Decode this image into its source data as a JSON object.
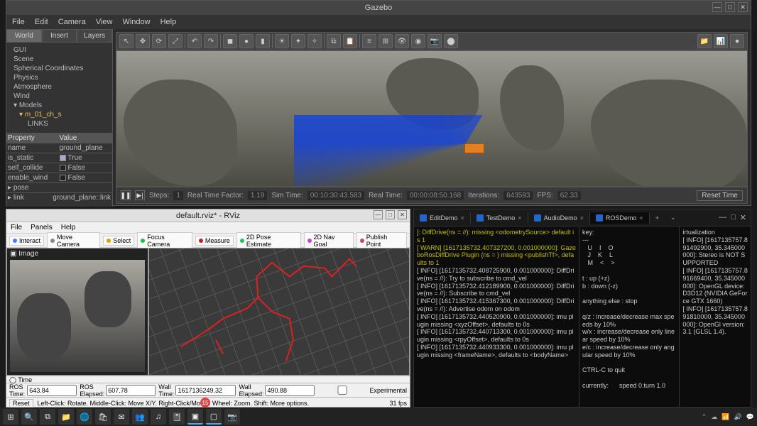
{
  "gazebo": {
    "title": "Gazebo",
    "menu": [
      "File",
      "Edit",
      "Camera",
      "View",
      "Window",
      "Help"
    ],
    "side_tabs": [
      "World",
      "Insert",
      "Layers"
    ],
    "tree": {
      "items": [
        "GUI",
        "Scene",
        "Spherical Coordinates",
        "Physics",
        "Atmosphere",
        "Wind"
      ],
      "models_label": "Models",
      "selected": "m_01_ch_s",
      "links_label": "LINKS"
    },
    "props": {
      "header_key": "Property",
      "header_val": "Value",
      "rows": [
        {
          "k": "name",
          "v": "ground_plane"
        },
        {
          "k": "is_static",
          "v": "True",
          "chk": true
        },
        {
          "k": "self_collide",
          "v": "False",
          "chk": false
        },
        {
          "k": "enable_wind",
          "v": "False",
          "chk": false
        },
        {
          "k": "pose",
          "v": ""
        },
        {
          "k": "link",
          "v": "ground_plane::link"
        }
      ]
    },
    "status": {
      "steps_label": "Steps:",
      "steps": "1",
      "rtf_label": "Real Time Factor:",
      "rtf": "1.19",
      "simtime_label": "Sim Time:",
      "simtime": "00:10:30:43.583",
      "realtime_label": "Real Time:",
      "realtime": "00:00:08:50.168",
      "iter_label": "Iterations:",
      "iter": "643593",
      "fps_label": "FPS:",
      "fps": "62.33",
      "reset": "Reset Time"
    }
  },
  "rviz": {
    "title": "default.rviz* - RViz",
    "menu": [
      "File",
      "Panels",
      "Help"
    ],
    "toolbar": [
      {
        "label": "Interact",
        "color": "#4080ff"
      },
      {
        "label": "Move Camera",
        "color": "#888"
      },
      {
        "label": "Select",
        "color": "#e0a000"
      },
      {
        "label": "Focus Camera",
        "color": "#20c040"
      },
      {
        "label": "Measure",
        "color": "#c02020"
      },
      {
        "label": "2D Pose Estimate",
        "color": "#20c060"
      },
      {
        "label": "2D Nav Goal",
        "color": "#d040d0"
      },
      {
        "label": "Publish Point",
        "color": "#d04080"
      }
    ],
    "image_panel": "Image",
    "time_panel": "Time",
    "time": {
      "ros_time_l": "ROS Time:",
      "ros_time": "643.84",
      "ros_el_l": "ROS Elapsed:",
      "ros_el": "607.78",
      "wall_time_l": "Wall Time:",
      "wall_time": "1617136249.32",
      "wall_el_l": "Wall Elapsed:",
      "wall_el": "490.88",
      "experimental": "Experimental"
    },
    "status": {
      "reset": "Reset",
      "help": "Left-Click: Rotate.  Middle-Click: Move X/Y.  Right-Click/Mouse Wheel: Zoom.  Shift: More options.",
      "fps": "31 fps"
    }
  },
  "terminal": {
    "tabs": [
      "EditDemo",
      "TestDemo",
      "AudioDemo",
      "ROSDemo"
    ],
    "selected_tab": 3,
    "col1": "]: DiffDrive(ns = //): missing <odometrySource> default is 1\n[ WARN] [1617135732.407327200, 0.001000000]: GazeboRosDiffDrive Plugin (ns = ) missing <publishTf>, defaults to 1\n[ INFO] [1617135732.408725900, 0.001000000]: DiffDrive(ns = //): Try to subscribe to cmd_vel\n[ INFO] [1617135732.412189900, 0.001000000]: DiffDrive(ns = //): Subscribe to cmd_vel\n[ INFO] [1617135732.415367300, 0.001000000]: DiffDrive(ns = //): Advertise odom on odom\n[ INFO] [1617135732.440520900, 0.001000000]: imu plugin missing <xyzOffset>, defaults to 0s\n[ INFO] [1617135732.440713300, 0.001000000]: imu plugin missing <rpyOffset>, defaults to 0s\n[ INFO] [1617135732.440933300, 0.001000000]: imu plugin missing <frameName>, defaults to <bodyName>",
    "col2": "key:\n---\n   U    I    O\n   J    K    L\n   M    <    >\n\nt : up (+z)\nb : down (-z)\n\nanything else : stop\n\nq/z : increase/decrease max speeds by 10%\nw/x : increase/decrease only linear speed by 10%\ne/c : increase/decrease only angular speed by 10%\n\nCTRL-C to quit\n\ncurrently:      speed 0.turn 1.0",
    "col3": "irtualization\n[ INFO] [1617135757.891492900, 35.345000000]: Stereo is NOT SUPPORTED\n[ INFO] [1617135757.891669400, 35.345000000]: OpenGL device: D3D12 (NVIDIA GeForce GTX 1660)\n[ INFO] [1617135757.891810000, 35.345000000]: OpenGl version: 3.1 (GLSL 1.4)."
  },
  "taskbar": {
    "notification_count": "15"
  }
}
